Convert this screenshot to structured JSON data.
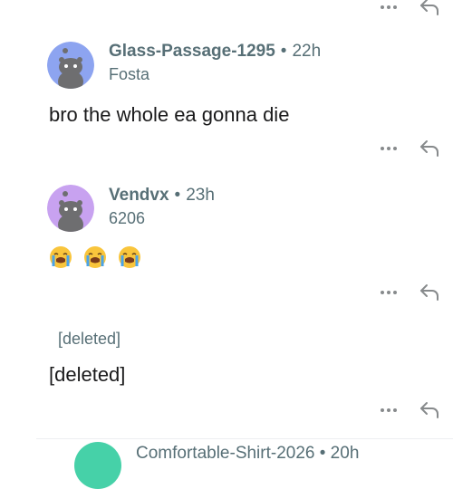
{
  "comments": [
    {
      "author": "Glass-Passage-1295",
      "separator": "•",
      "time": "22h",
      "flair": "Fosta",
      "body": "bro the whole ea gonna die",
      "avatar_color": "#8da4f0"
    },
    {
      "author": "Vendvx",
      "separator": "•",
      "time": "23h",
      "flair": "6206",
      "body_emojis": [
        "loudly-crying-face",
        "loudly-crying-face",
        "loudly-crying-face"
      ],
      "avatar_color": "#c8a2f0"
    },
    {
      "author": "[deleted]",
      "body": "[deleted]"
    }
  ],
  "icons": {
    "more": "more-options-icon",
    "reply": "reply-arrow-icon"
  },
  "next_comment": {
    "author_partial": "Comfortable-Shirt-2026 • 20h",
    "avatar_color": "#46d1a8"
  },
  "colors": {
    "meta_text": "#576f76",
    "body_text": "#1a1a1b",
    "icon": "#878a8c"
  }
}
